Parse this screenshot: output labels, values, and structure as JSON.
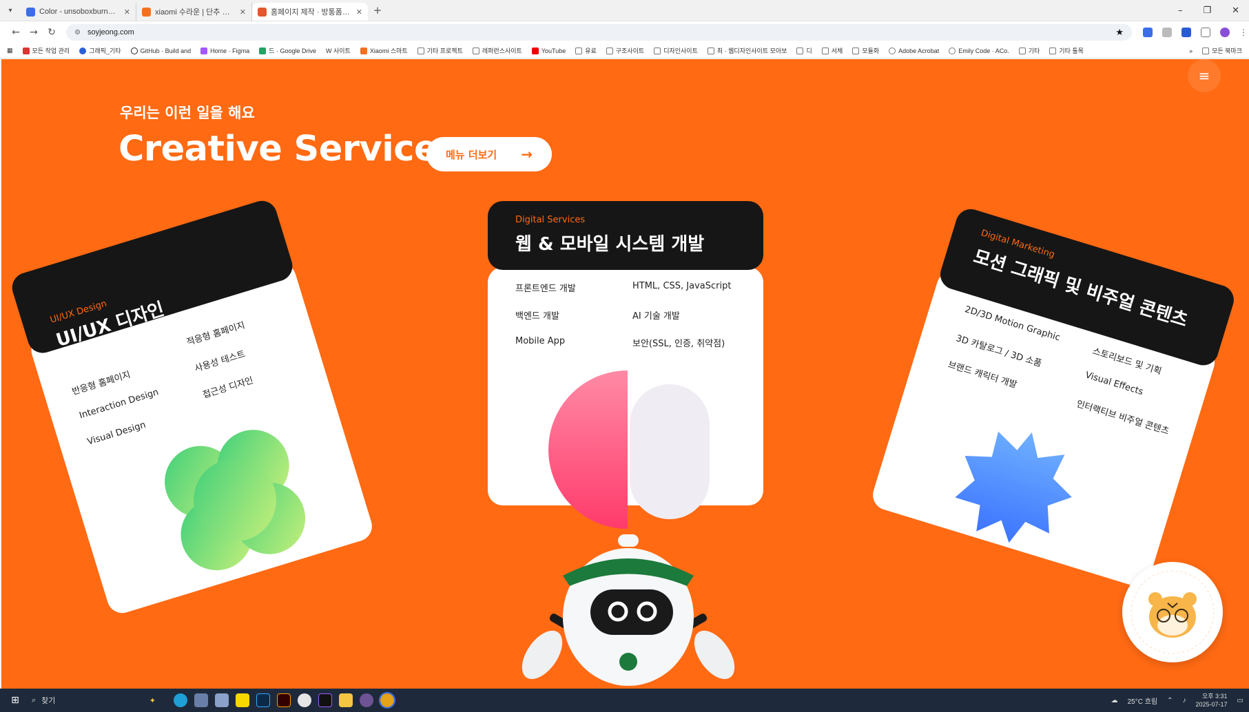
{
  "browser": {
    "tabs": [
      {
        "title": "Color - unsoboxburne su.do",
        "color": "#3b6ee8",
        "active": false
      },
      {
        "title": "xiaomi 수라운 | 단추 조석",
        "color": "#f37021",
        "active": false
      },
      {
        "title": "홈페이지 제작 · 방통폼 홈페이",
        "color": "#e8542c",
        "active": true
      }
    ],
    "new_tab": "+",
    "window_controls": [
      "–",
      "❐",
      "✕"
    ],
    "url": "soyjeong.com",
    "bookmarks": [
      "모든 작업 관리",
      "그래픽_기타",
      "GitHub · Build and",
      "Home · Figma",
      "드 · Google Drive",
      "W 사이트",
      "Xiaomi 스마트",
      "기타 프로젝트",
      "레퍼런스사이트",
      "YouTube",
      "유료",
      "구조사이트",
      "디자인사이트",
      "최 · 웹디자인사이트 모아보",
      "디",
      "서체",
      "모듈화",
      "Adobe Acrobat",
      "Emily Code · ACo.",
      "기타",
      "기타 툴목"
    ],
    "bookmarks_overflow": "»",
    "bookmarks_other": "모든 북마크"
  },
  "page": {
    "eyebrow": "우리는 이런 일을 해요",
    "headline": "Creative Service",
    "more_button": "메뉴 더보기",
    "more_arrow": "→",
    "menu_icon": "≡",
    "cards": [
      {
        "category": "UI/UX Design",
        "title": "UI/UX 디자인",
        "col1": [
          "반응형 홈페이지",
          "Interaction Design",
          "Visual Design"
        ],
        "col2": [
          "적응형 홈페이지",
          "사용성 테스트",
          "접근성 디자인"
        ]
      },
      {
        "category": "Digital Services",
        "title": "웹 & 모바일 시스템 개발",
        "col1": [
          "프론트엔드 개발",
          "백엔드 개발",
          "Mobile App"
        ],
        "col2": [
          "HTML, CSS, JavaScript",
          "AI 기술 개발",
          "보안(SSL, 인증, 취약점)"
        ]
      },
      {
        "category": "Digital Marketing",
        "title": "모션 그래픽 및 비주얼 콘텐츠",
        "col1": [
          "2D/3D Motion Graphic",
          "3D 카탈로그 / 3D 소품",
          "브랜드 캐릭터 개발"
        ],
        "col2": [
          "스토리보드 및 기획",
          "Visual Effects",
          "인터랙티브 비주얼 콘텐츠"
        ]
      }
    ]
  },
  "colors": {
    "brand_orange": "#ff6a13",
    "card_dark": "#161616",
    "green_shape": "#5fd98a",
    "pink_shape": "#ff4e7a",
    "blue_shape": "#4a8cff"
  },
  "taskbar": {
    "search_placeholder": "찾기",
    "weather": "25°C 흐림",
    "time": "오후 3:31",
    "date": "2025-07-17"
  }
}
